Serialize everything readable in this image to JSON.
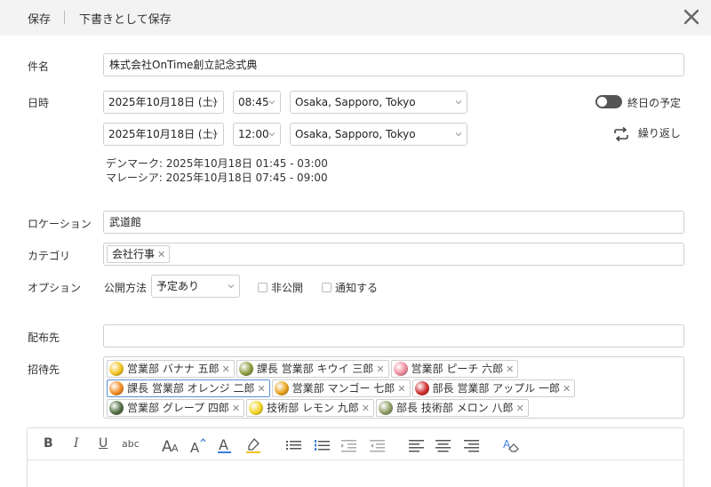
{
  "toolbar": {
    "save": "保存",
    "save_draft": "下書きとして保存"
  },
  "form": {
    "subject_label": "件名",
    "subject_value": "株式会社OnTime創立記念式典",
    "datetime_label": "日時",
    "start": {
      "date": "2025年10月18日 (土)",
      "time": "08:45",
      "timezone": "Osaka, Sapporo, Tokyo"
    },
    "end": {
      "date": "2025年10月18日 (土)",
      "time": "12:00",
      "timezone": "Osaka, Sapporo, Tokyo"
    },
    "all_day_label": "終日の予定",
    "repeat_label": "繰り返し",
    "other_timezones": [
      "デンマーク: 2025年10月18日 01:45  -  03:00",
      "マレーシア: 2025年10月18日 07:45  -  09:00"
    ],
    "location_label": "ロケーション",
    "location_value": "武道館",
    "category_label": "カテゴリ",
    "categories": [
      "会社行事"
    ],
    "options_label": "オプション",
    "disclosure_label": "公開方法",
    "disclosure_value": "予定あり",
    "private_label": "非公開",
    "notify_label": "通知する",
    "distribution_label": "配布先",
    "distribution_value": "",
    "invitees_label": "招待先",
    "invitees": [
      {
        "name": "営業部 バナナ 五郎",
        "color": "#f2c21b",
        "icon": "banana-icon"
      },
      {
        "name": "課長 営業部 キウイ 三郎",
        "color": "#8a9a3b",
        "icon": "kiwi-icon"
      },
      {
        "name": "営業部 ピーチ 六郎",
        "color": "#f08a9a",
        "icon": "peach-icon"
      },
      {
        "name": "課長 営業部 オレンジ 二郎",
        "color": "#f08a1c",
        "icon": "orange-icon"
      },
      {
        "name": "営業部 マンゴー 七郎",
        "color": "#e8a017",
        "icon": "mango-icon"
      },
      {
        "name": "部長 営業部 アップル 一郎",
        "color": "#cf2b2b",
        "icon": "apple-icon"
      },
      {
        "name": "営業部 グレープ 四郎",
        "color": "#4d6b3f",
        "icon": "grape-icon"
      },
      {
        "name": "技術部 レモン 九郎",
        "color": "#f5d31e",
        "icon": "lemon-icon"
      },
      {
        "name": "部長 技術部 メロン 八郎",
        "color": "#8d9a62",
        "icon": "melon-icon"
      }
    ]
  },
  "editor_toolbar": {
    "bold": "B",
    "italic": "I",
    "underline": "U",
    "strikethrough": "abc"
  }
}
